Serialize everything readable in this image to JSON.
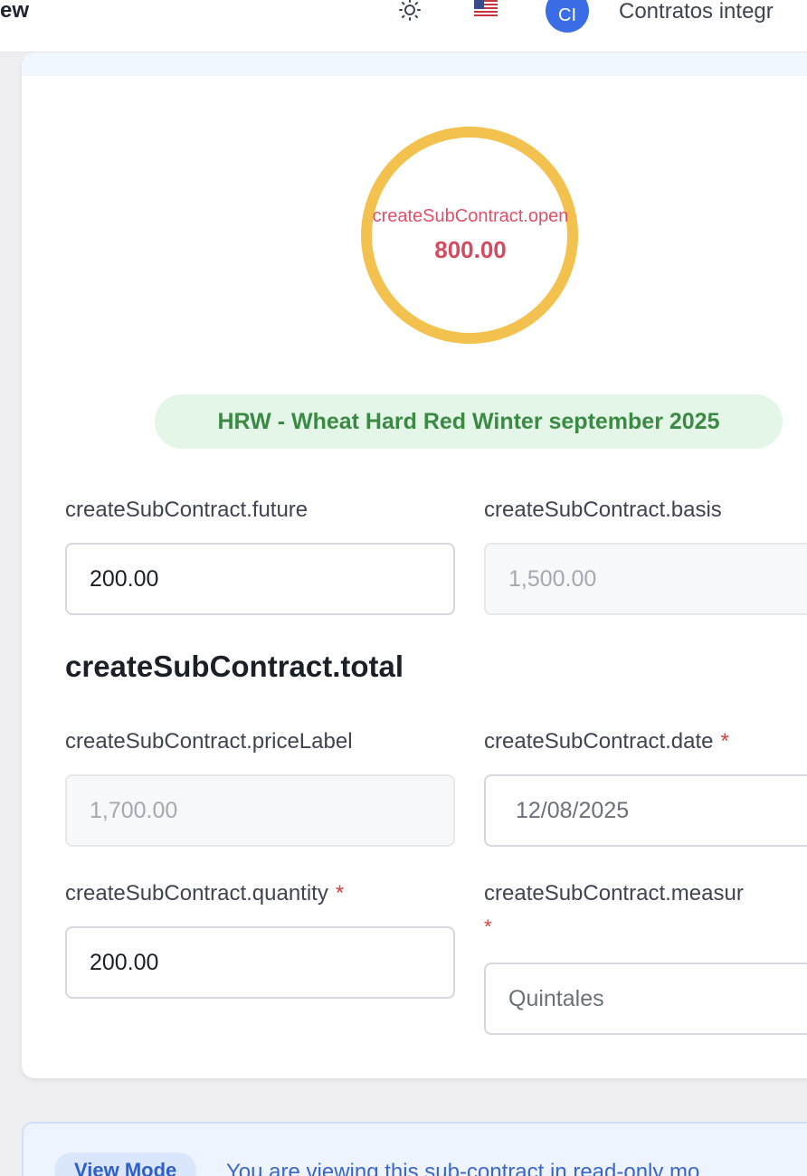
{
  "header": {
    "title_fragment": "ew",
    "theme_icon": "sun-icon",
    "language_icon": "us-flag-icon",
    "avatar_initials": "CI",
    "org_name": "Contratos integr"
  },
  "summary": {
    "open_label": "createSubContract.open",
    "open_value": "800.00",
    "ring_color": "#f2c14e",
    "commodity_pill": "HRW - Wheat Hard Red Winter september 2025"
  },
  "form": {
    "future_label": "createSubContract.future",
    "future_value": "200.00",
    "basis_label": "createSubContract.basis",
    "basis_value": "1,500.00",
    "total_title": "createSubContract.total",
    "price_label": "createSubContract.priceLabel",
    "price_value": "1,700.00",
    "date_label": "createSubContract.date",
    "date_value": "12/08/2025",
    "quantity_label": "createSubContract.quantity",
    "quantity_value": "200.00",
    "measure_label": "createSubContract.measur",
    "measure_value": "Quintales",
    "required_marker": "*"
  },
  "notice": {
    "badge": "View Mode",
    "text": "You are viewing this sub-contract in read-only mo"
  }
}
